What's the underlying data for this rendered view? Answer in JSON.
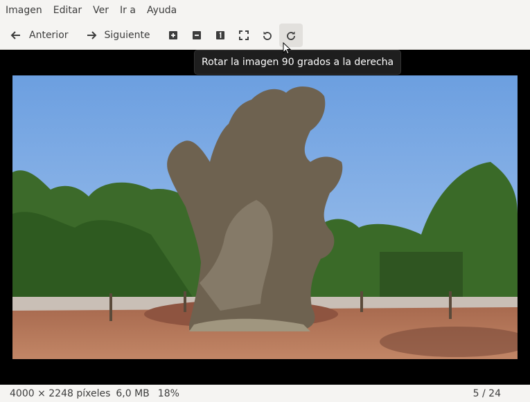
{
  "menubar": {
    "items": [
      "Imagen",
      "Editar",
      "Ver",
      "Ir a",
      "Ayuda"
    ]
  },
  "toolbar": {
    "previous_label": "Anterior",
    "next_label": "Siguiente",
    "icons": [
      "arrow-left-icon",
      "arrow-right-icon",
      "zoom-in-icon",
      "zoom-out-icon",
      "zoom-normal-icon",
      "zoom-fit-icon",
      "rotate-left-icon",
      "rotate-right-icon"
    ]
  },
  "tooltip": {
    "text": "Rotar la imagen 90 grados a la derecha"
  },
  "image": {
    "subject": "old-olive-tree-photo",
    "colors": {
      "sky": "#7eaee6",
      "ground": "#b7765a",
      "foliage": "#3c6a2a",
      "trunk": "#6e6250"
    }
  },
  "statusbar": {
    "dimensions": "4000 × 2248 píxeles",
    "file_size": "6,0 MB",
    "zoom": "18%",
    "position": "5 / 24"
  }
}
